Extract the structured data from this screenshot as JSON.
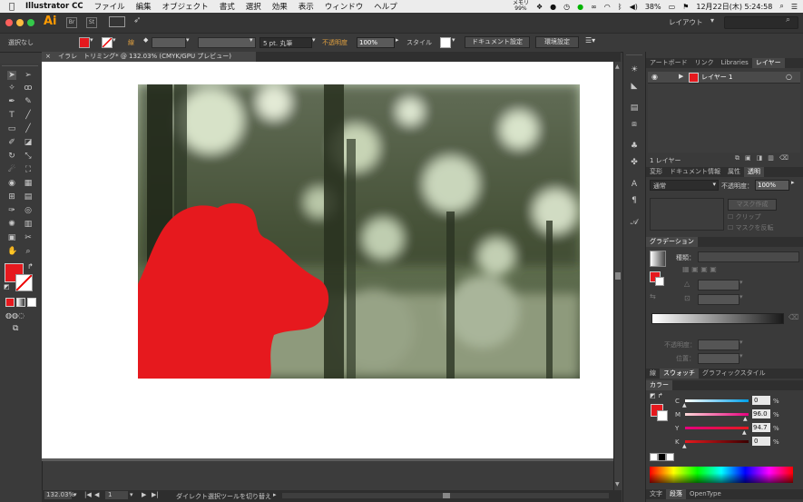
{
  "menubar": {
    "app_name": "Illustrator CC",
    "items": [
      "ファイル",
      "編集",
      "オブジェクト",
      "書式",
      "選択",
      "効果",
      "表示",
      "ウィンドウ",
      "ヘルプ"
    ],
    "memory": "メモリ\n99%",
    "battery": "38%",
    "clock": "12月22日(木) 5:24:58"
  },
  "appbar": {
    "logo": "Ai",
    "br": "Br",
    "st": "St",
    "workspace": "レイアウト"
  },
  "controlbar": {
    "selection": "選択なし",
    "stroke_label": "線",
    "brush": "5 pt. 丸筆",
    "opacity_label": "不透明度",
    "opacity_value": "100%",
    "style_label": "スタイル",
    "doc_settings": "ドキュメント設定",
    "prefs": "環境設定"
  },
  "tab": {
    "close": "×",
    "title": "イラレ　トリミング* @ 132.03% (CMYK/GPU プレビュー)"
  },
  "status": {
    "zoom": "132.03%",
    "artboard": "1",
    "tool": "ダイレクト選択ツールを切り替え"
  },
  "layers_panel": {
    "tabs": [
      "アートボード",
      "リンク",
      "Libraries",
      "レイヤー"
    ],
    "layer_name": "レイヤー 1",
    "footer": "1 レイヤー"
  },
  "transparency_panel": {
    "tabs": [
      "変形",
      "ドキュメント情報",
      "属性",
      "透明"
    ],
    "blend_mode": "通常",
    "opacity_label": "不透明度：",
    "opacity_value": "100%",
    "make_mask": "マスク作成",
    "clip": "クリップ",
    "invert_mask": "マスクを反転"
  },
  "gradient_panel": {
    "tab": "グラデーション",
    "type_label": "種類：",
    "opacity_label": "不透明度：",
    "position_label": "位置："
  },
  "swatch_bar": {
    "tabs": [
      "線",
      "スウォッチ",
      "グラフィックスタイル"
    ]
  },
  "color_panel": {
    "tab": "カラー",
    "channels": [
      {
        "name": "C",
        "value": "0",
        "unit": "%",
        "color": "#e8e8e8"
      },
      {
        "name": "M",
        "value": "96.0",
        "unit": "%",
        "color": "#e6007e"
      },
      {
        "name": "Y",
        "value": "94.7",
        "unit": "%",
        "color": "#fff100"
      },
      {
        "name": "K",
        "value": "0",
        "unit": "%",
        "color": "#111111"
      }
    ]
  },
  "bottom_tabs": [
    "文字",
    "段落",
    "OpenType"
  ],
  "colors": {
    "fill": "#e6191e",
    "artboard": "#ffffff",
    "ui": "#3a3a3a"
  }
}
